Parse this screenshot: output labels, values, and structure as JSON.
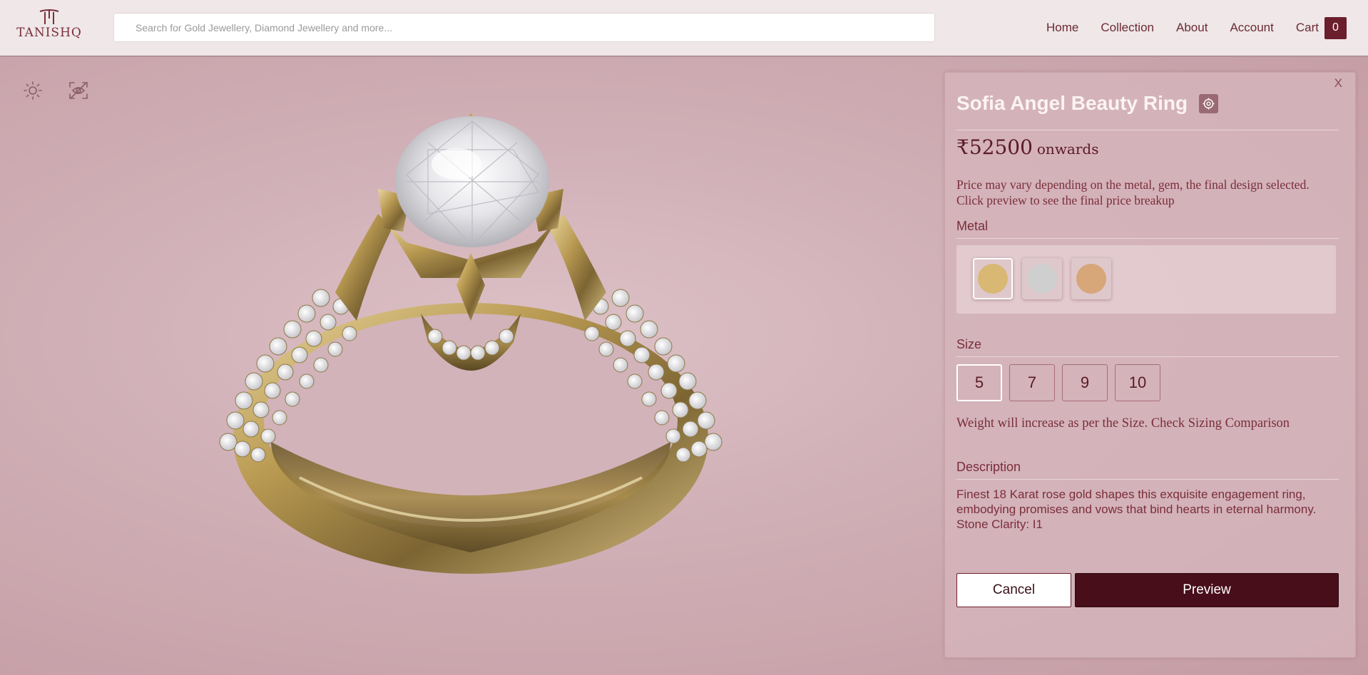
{
  "brand": {
    "logo_text": "TANISHQ"
  },
  "search": {
    "placeholder": "Search for Gold Jewellery, Diamond Jewellery and more..."
  },
  "nav": {
    "items": [
      "Home",
      "Collection",
      "About",
      "Account",
      "Cart"
    ],
    "cart_count": "0"
  },
  "viewer": {
    "tools": [
      "sun-icon",
      "hide-view-icon"
    ]
  },
  "product": {
    "close_label": "X",
    "name": "Sofia Angel Beauty Ring",
    "price": "₹52500",
    "price_suffix": "onwards",
    "price_note_line1": "Price may vary depending on the metal, gem, the final design selected.",
    "price_note_line2": "Click preview to see the final price breakup",
    "metal_label": "Metal",
    "metals": [
      {
        "name": "yellow-gold",
        "color": "#d8b873",
        "selected": true
      },
      {
        "name": "white-gold",
        "color": "#cfcfcf",
        "selected": false
      },
      {
        "name": "rose-gold",
        "color": "#d7a679",
        "selected": false
      }
    ],
    "size_label": "Size",
    "sizes": [
      "5",
      "7",
      "9",
      "10"
    ],
    "selected_size": "5",
    "weight_note": "Weight will increase as per the Size. Check Sizing Comparison",
    "description_label": "Description",
    "description_line1": "Finest 18 Karat rose gold shapes this exquisite engagement ring,",
    "description_line2": "embodying promises and vows that bind hearts in eternal harmony.",
    "description_line3": "Stone Clarity: I1",
    "cancel_label": "Cancel",
    "preview_label": "Preview"
  },
  "colors": {
    "accent": "#480e19",
    "header_bg": "#efe7e8",
    "viewer_bg": "#d4b5bb",
    "gold": "#b59a55"
  }
}
